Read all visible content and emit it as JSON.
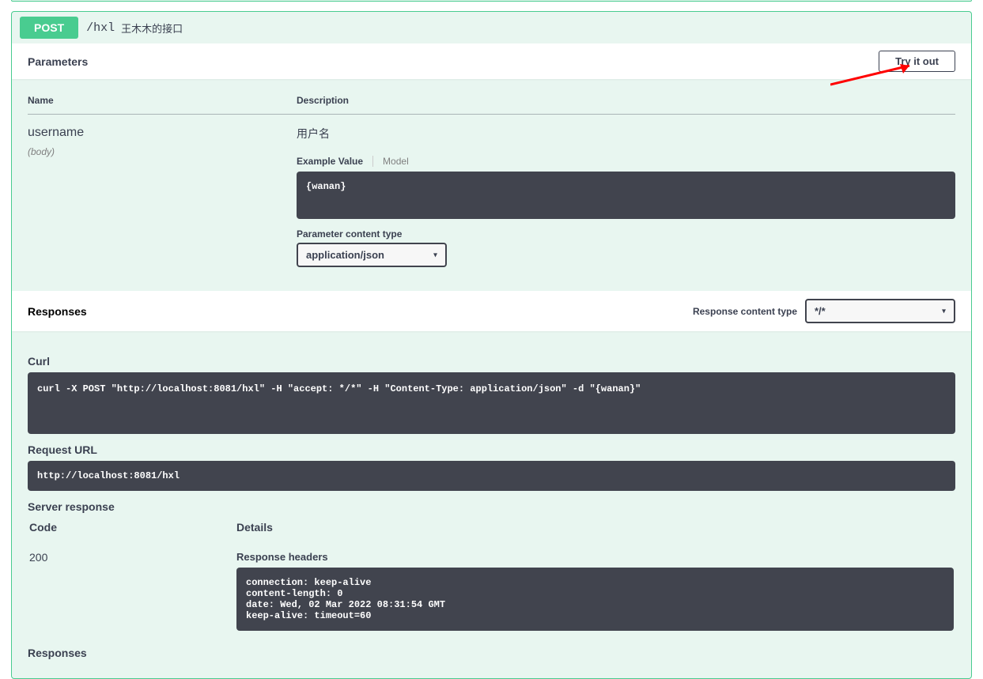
{
  "endpoint": {
    "method": "POST",
    "path": "/hxl",
    "description": "王木木的接口"
  },
  "parameters": {
    "title": "Parameters",
    "try_it_out": "Try it out",
    "columns": {
      "name": "Name",
      "description": "Description"
    },
    "rows": [
      {
        "name": "username",
        "in": "(body)",
        "description": "用户名",
        "tabs": {
          "example": "Example Value",
          "model": "Model"
        },
        "example_value": "{wanan}",
        "content_type_label": "Parameter content type",
        "content_type_value": "application/json"
      }
    ]
  },
  "responses": {
    "title": "Responses",
    "content_type_label": "Response content type",
    "content_type_value": "*/*",
    "curl_label": "Curl",
    "curl_value": "curl -X POST \"http://localhost:8081/hxl\" -H \"accept: */*\" -H \"Content-Type: application/json\" -d \"{wanan}\"",
    "request_url_label": "Request URL",
    "request_url_value": "http://localhost:8081/hxl",
    "server_response_label": "Server response",
    "code_col": "Code",
    "details_col": "Details",
    "rows": [
      {
        "code": "200",
        "headers_label": "Response headers",
        "headers_value": "connection: keep-alive\ncontent-length: 0\ndate: Wed, 02 Mar 2022 08:31:54 GMT\nkeep-alive: timeout=60"
      }
    ],
    "responses_label": "Responses"
  }
}
